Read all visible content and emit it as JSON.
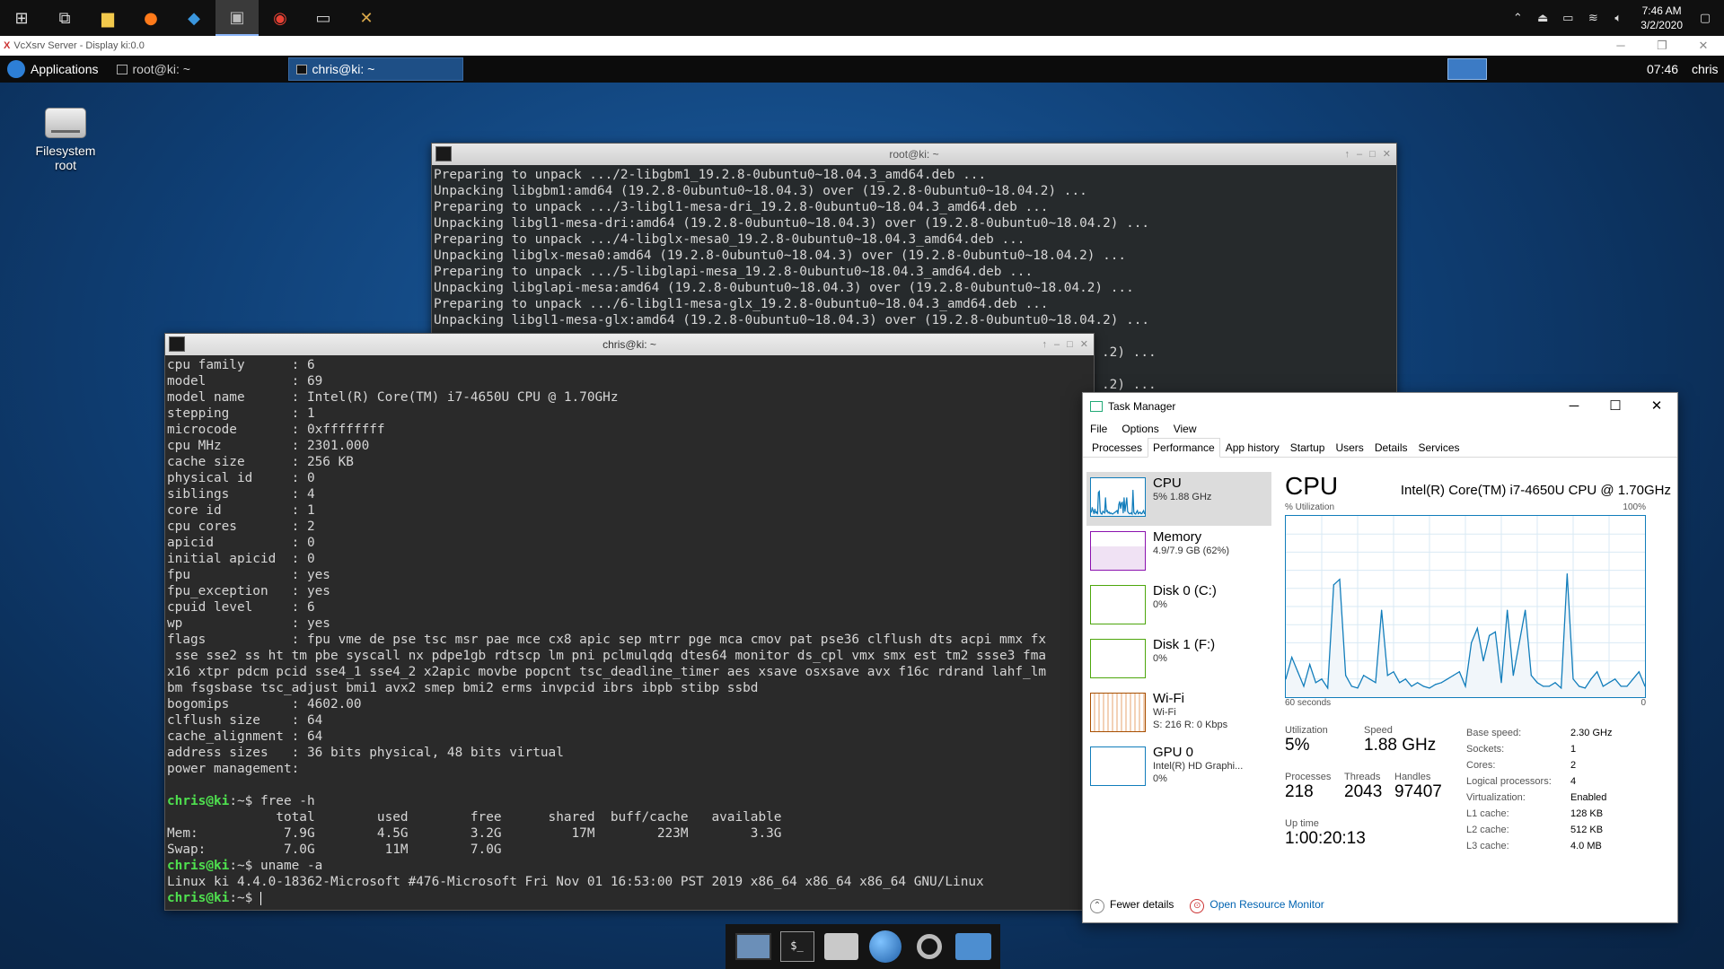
{
  "windows_taskbar": {
    "clock_time": "7:46 AM",
    "clock_date": "3/2/2020",
    "icons": [
      "windows-start-icon",
      "task-view-icon",
      "file-explorer-icon",
      "firefox-icon",
      "vscode-icon",
      "vcxsrv-icon",
      "chrome-icon",
      "terminal-icon",
      "xlaunch-icon"
    ]
  },
  "vcxsrv": {
    "title": "VcXsrv Server - Display ki:0.0",
    "logo_text": "X"
  },
  "xfce_panel": {
    "applications_label": "Applications",
    "tasks": [
      {
        "label": "root@ki: ~",
        "active": false
      },
      {
        "label": "chris@ki: ~",
        "active": true
      }
    ],
    "clock": "07:46",
    "user": "chris"
  },
  "desktop": {
    "icons": [
      {
        "label_line1": "Filesystem",
        "label_line2": "root"
      }
    ]
  },
  "root_terminal": {
    "title": "root@ki: ~",
    "lines": [
      "Preparing to unpack .../2-libgbm1_19.2.8-0ubuntu0~18.04.3_amd64.deb ...",
      "Unpacking libgbm1:amd64 (19.2.8-0ubuntu0~18.04.3) over (19.2.8-0ubuntu0~18.04.2) ...",
      "Preparing to unpack .../3-libgl1-mesa-dri_19.2.8-0ubuntu0~18.04.3_amd64.deb ...",
      "Unpacking libgl1-mesa-dri:amd64 (19.2.8-0ubuntu0~18.04.3) over (19.2.8-0ubuntu0~18.04.2) ...",
      "Preparing to unpack .../4-libglx-mesa0_19.2.8-0ubuntu0~18.04.3_amd64.deb ...",
      "Unpacking libglx-mesa0:amd64 (19.2.8-0ubuntu0~18.04.3) over (19.2.8-0ubuntu0~18.04.2) ...",
      "Preparing to unpack .../5-libglapi-mesa_19.2.8-0ubuntu0~18.04.3_amd64.deb ...",
      "Unpacking libglapi-mesa:amd64 (19.2.8-0ubuntu0~18.04.3) over (19.2.8-0ubuntu0~18.04.2) ...",
      "Preparing to unpack .../6-libgl1-mesa-glx_19.2.8-0ubuntu0~18.04.3_amd64.deb ...",
      "Unpacking libgl1-mesa-glx:amd64 (19.2.8-0ubuntu0~18.04.3) over (19.2.8-0ubuntu0~18.04.2) ..."
    ],
    "partial_line_1": ".2) ...",
    "partial_line_2": ".2) ..."
  },
  "chris_terminal": {
    "title": "chris@ki: ~",
    "cpuinfo": [
      "cpu family      : 6",
      "model           : 69",
      "model name      : Intel(R) Core(TM) i7-4650U CPU @ 1.70GHz",
      "stepping        : 1",
      "microcode       : 0xffffffff",
      "cpu MHz         : 2301.000",
      "cache size      : 256 KB",
      "physical id     : 0",
      "siblings        : 4",
      "core id         : 1",
      "cpu cores       : 2",
      "apicid          : 0",
      "initial apicid  : 0",
      "fpu             : yes",
      "fpu_exception   : yes",
      "cpuid level     : 6",
      "wp              : yes",
      "flags           : fpu vme de pse tsc msr pae mce cx8 apic sep mtrr pge mca cmov pat pse36 clflush dts acpi mmx fx",
      " sse sse2 ss ht tm pbe syscall nx pdpe1gb rdtscp lm pni pclmulqdq dtes64 monitor ds_cpl vmx smx est tm2 ssse3 fma",
      "x16 xtpr pdcm pcid sse4_1 sse4_2 x2apic movbe popcnt tsc_deadline_timer aes xsave osxsave avx f16c rdrand lahf_lm",
      "bm fsgsbase tsc_adjust bmi1 avx2 smep bmi2 erms invpcid ibrs ibpb stibp ssbd",
      "bogomips        : 4602.00",
      "clflush size    : 64",
      "cache_alignment : 64",
      "address sizes   : 36 bits physical, 48 bits virtual",
      "power management:",
      ""
    ],
    "prompt": "chris@ki",
    "prompt_suffix": ":~$ ",
    "cmd_free": "free -h",
    "free_header": "              total        used        free      shared  buff/cache   available",
    "free_mem": "Mem:           7.9G        4.5G        3.2G         17M        223M        3.3G",
    "free_swap": "Swap:          7.0G         11M        7.0G",
    "cmd_uname": "uname -a",
    "uname_output": "Linux ki 4.4.0-18362-Microsoft #476-Microsoft Fri Nov 01 16:53:00 PST 2019 x86_64 x86_64 x86_64 GNU/Linux"
  },
  "task_manager": {
    "title": "Task Manager",
    "menu": [
      "File",
      "Options",
      "View"
    ],
    "tabs": [
      "Processes",
      "Performance",
      "App history",
      "Startup",
      "Users",
      "Details",
      "Services"
    ],
    "active_tab": "Performance",
    "sidebar": [
      {
        "name": "CPU",
        "sub1": "5%  1.88 GHz",
        "sub2": "",
        "color": "#117dbb"
      },
      {
        "name": "Memory",
        "sub1": "4.9/7.9 GB (62%)",
        "sub2": "",
        "color": "#8b12ae"
      },
      {
        "name": "Disk 0 (C:)",
        "sub1": "0%",
        "sub2": "",
        "color": "#4da60c"
      },
      {
        "name": "Disk 1 (F:)",
        "sub1": "0%",
        "sub2": "",
        "color": "#4da60c"
      },
      {
        "name": "Wi-Fi",
        "sub1": "Wi-Fi",
        "sub2": "S: 216  R: 0 Kbps",
        "color": "#a74f01"
      },
      {
        "name": "GPU 0",
        "sub1": "Intel(R) HD Graphi...",
        "sub2": "0%",
        "color": "#117dbb"
      }
    ],
    "cpu": {
      "heading": "CPU",
      "model": "Intel(R) Core(TM) i7-4650U CPU @ 1.70GHz",
      "utilization_label": "% Utilization",
      "max_label": "100%",
      "time_label": "60 seconds",
      "min_label": "0",
      "utilization_label2": "Utilization",
      "utilization": "5%",
      "speed_label": "Speed",
      "speed": "1.88 GHz",
      "processes_label": "Processes",
      "processes": "218",
      "threads_label": "Threads",
      "threads": "2043",
      "handles_label": "Handles",
      "handles": "97407",
      "uptime_label": "Up time",
      "uptime": "1:00:20:13",
      "specs": [
        {
          "k": "Base speed:",
          "v": "2.30 GHz"
        },
        {
          "k": "Sockets:",
          "v": "1"
        },
        {
          "k": "Cores:",
          "v": "2"
        },
        {
          "k": "Logical processors:",
          "v": "4"
        },
        {
          "k": "Virtualization:",
          "v": "Enabled"
        },
        {
          "k": "L1 cache:",
          "v": "128 KB"
        },
        {
          "k": "L2 cache:",
          "v": "512 KB"
        },
        {
          "k": "L3 cache:",
          "v": "4.0 MB"
        }
      ]
    },
    "footer": {
      "fewer_details": "Fewer details",
      "open_resource_monitor": "Open Resource Monitor"
    }
  },
  "chart_data": {
    "type": "line",
    "title": "",
    "xlabel": "60 seconds",
    "ylabel": "% Utilization",
    "ylim": [
      0,
      100
    ],
    "x": [
      0,
      1,
      2,
      3,
      4,
      5,
      6,
      7,
      8,
      9,
      10,
      11,
      12,
      13,
      14,
      15,
      16,
      17,
      18,
      19,
      20,
      21,
      22,
      23,
      24,
      25,
      26,
      27,
      28,
      29,
      30,
      31,
      32,
      33,
      34,
      35,
      36,
      37,
      38,
      39,
      40,
      41,
      42,
      43,
      44,
      45,
      46,
      47,
      48,
      49,
      50,
      51,
      52,
      53,
      54,
      55,
      56,
      57,
      58,
      59,
      60
    ],
    "series": [
      {
        "values": [
          10,
          22,
          14,
          6,
          18,
          8,
          10,
          5,
          62,
          65,
          12,
          6,
          5,
          12,
          10,
          8,
          48,
          12,
          14,
          8,
          10,
          6,
          8,
          6,
          5,
          7,
          8,
          10,
          12,
          14,
          6,
          30,
          38,
          20,
          34,
          36,
          8,
          48,
          12,
          30,
          48,
          12,
          8,
          6,
          6,
          8,
          5,
          68,
          10,
          6,
          5,
          10,
          14,
          6,
          8,
          10,
          6,
          6,
          10,
          14,
          6
        ]
      }
    ],
    "grid": true
  }
}
